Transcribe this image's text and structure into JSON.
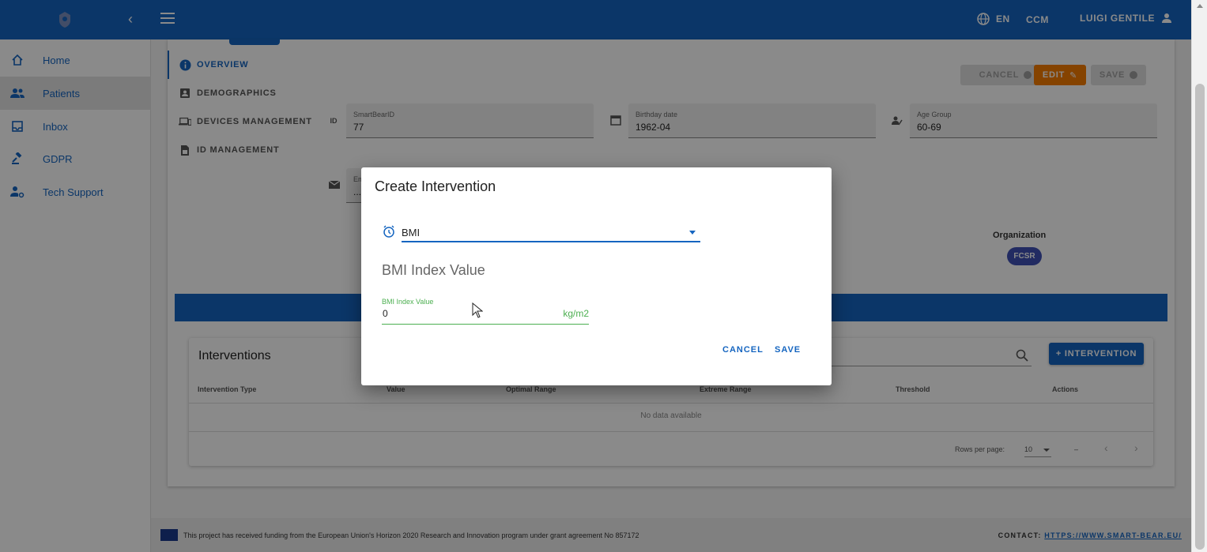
{
  "header": {
    "lang": "EN",
    "ccm": "CCM",
    "user": "LUIGI GENTILE"
  },
  "sidebar": {
    "items": [
      {
        "label": "Home",
        "icon": "home-icon"
      },
      {
        "label": "Patients",
        "icon": "patients-icon"
      },
      {
        "label": "Inbox",
        "icon": "inbox-icon"
      },
      {
        "label": "GDPR",
        "icon": "gavel-icon"
      },
      {
        "label": "Tech Support",
        "icon": "support-icon"
      }
    ],
    "active": "Patients"
  },
  "tabs": [
    {
      "label": "OVERVIEW",
      "icon": "info-icon"
    },
    {
      "label": "DEMOGRAPHICS",
      "icon": "contact-card-icon"
    },
    {
      "label": "DEVICES MANAGEMENT",
      "icon": "devices-icon"
    },
    {
      "label": "ID MANAGEMENT",
      "icon": "sim-card-icon"
    }
  ],
  "actions": {
    "cancel": "CANCEL",
    "edit": "EDIT",
    "save": "SAVE"
  },
  "fields": {
    "smartbear_id": {
      "label": "SmartBearID",
      "value": "77",
      "icon_text": "ID"
    },
    "birthday": {
      "label": "Birthday date",
      "value": "1962-04"
    },
    "age_group": {
      "label": "Age Group",
      "value": "60-69"
    },
    "email": {
      "label": "Em",
      "value": "..."
    }
  },
  "organization": {
    "label": "Organization",
    "chip": "FCSR"
  },
  "interventions": {
    "title": "Interventions",
    "add_button": "+ INTERVENTION",
    "columns": [
      "Intervention Type",
      "Value",
      "Optimal Range",
      "Extreme Range",
      "Threshold",
      "Actions"
    ],
    "empty": "No data available",
    "rows_per_page_label": "Rows per page:",
    "rows_per_page": "10",
    "range": "–"
  },
  "footer": {
    "funding": "This project has received funding from the European Union's Horizon 2020 Research and Innovation program under grant agreement No 857172",
    "contact_label": "CONTACT:",
    "contact_link": "HTTPS://WWW.SMART-BEAR.EU/"
  },
  "dialog": {
    "title": "Create Intervention",
    "selected_type": "BMI",
    "section_title": "BMI Index Value",
    "field_label": "BMI Index Value",
    "field_value": "0",
    "field_suffix": "kg/m2",
    "cancel": "CANCEL",
    "save": "SAVE"
  },
  "colors": {
    "primary": "#1565c0",
    "edit": "#f57c00",
    "valid": "#4caf50",
    "chip": "#3f51b5"
  }
}
